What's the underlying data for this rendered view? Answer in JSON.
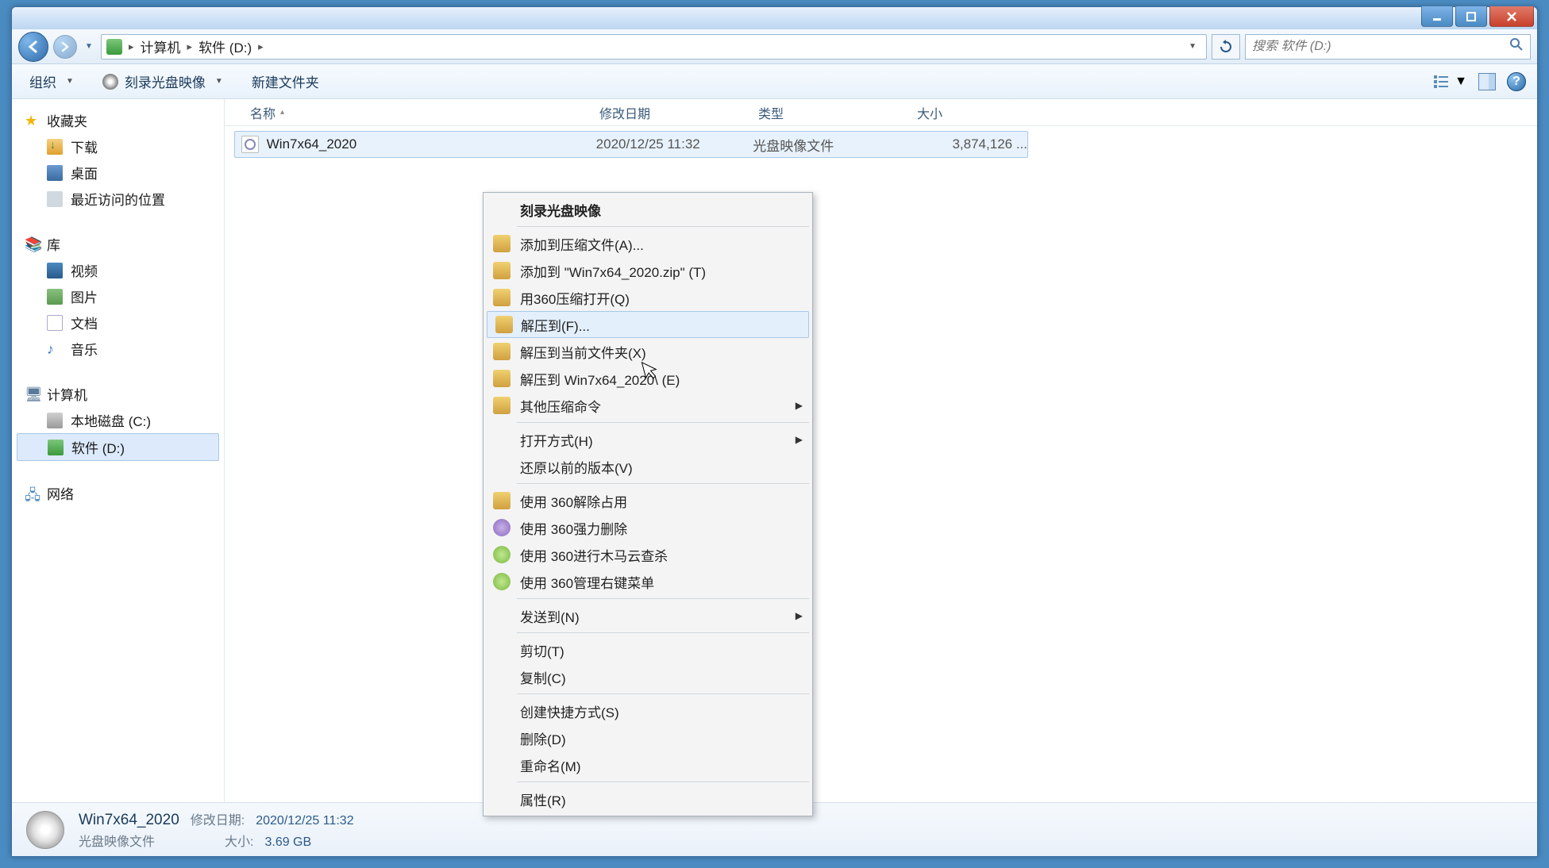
{
  "titlebar": {},
  "nav": {
    "breadcrumb": [
      "计算机",
      "软件 (D:)"
    ],
    "search_placeholder": "搜索 软件 (D:)"
  },
  "toolbar": {
    "organize": "组织",
    "burn": "刻录光盘映像",
    "newfolder": "新建文件夹"
  },
  "sidebar": {
    "favorites_header": "收藏夹",
    "favorites": [
      "下载",
      "桌面",
      "最近访问的位置"
    ],
    "libraries_header": "库",
    "libraries": [
      "视频",
      "图片",
      "文档",
      "音乐"
    ],
    "computer_header": "计算机",
    "drives": [
      "本地磁盘 (C:)",
      "软件 (D:)"
    ],
    "network_header": "网络"
  },
  "columns": {
    "name": "名称",
    "date": "修改日期",
    "type": "类型",
    "size": "大小"
  },
  "files": [
    {
      "name": "Win7x64_2020",
      "date": "2020/12/25 11:32",
      "type": "光盘映像文件",
      "size": "3,874,126 ..."
    }
  ],
  "context_menu": {
    "items": [
      {
        "label": "刻录光盘映像",
        "bold": true
      },
      {
        "sep": true
      },
      {
        "label": "添加到压缩文件(A)...",
        "icon": "zip"
      },
      {
        "label": "添加到 \"Win7x64_2020.zip\" (T)",
        "icon": "zip"
      },
      {
        "label": "用360压缩打开(Q)",
        "icon": "zip"
      },
      {
        "label": "解压到(F)...",
        "icon": "zip",
        "hover": true
      },
      {
        "label": "解压到当前文件夹(X)",
        "icon": "zip"
      },
      {
        "label": "解压到 Win7x64_2020\\ (E)",
        "icon": "zip"
      },
      {
        "label": "其他压缩命令",
        "icon": "zip",
        "submenu": true
      },
      {
        "sep": true
      },
      {
        "label": "打开方式(H)",
        "submenu": true
      },
      {
        "label": "还原以前的版本(V)"
      },
      {
        "sep": true
      },
      {
        "label": "使用 360解除占用",
        "icon": "box"
      },
      {
        "label": "使用 360强力删除",
        "icon": "purple"
      },
      {
        "label": "使用 360进行木马云查杀",
        "icon": "green"
      },
      {
        "label": "使用 360管理右键菜单",
        "icon": "green"
      },
      {
        "sep": true
      },
      {
        "label": "发送到(N)",
        "submenu": true
      },
      {
        "sep": true
      },
      {
        "label": "剪切(T)"
      },
      {
        "label": "复制(C)"
      },
      {
        "sep": true
      },
      {
        "label": "创建快捷方式(S)"
      },
      {
        "label": "删除(D)"
      },
      {
        "label": "重命名(M)"
      },
      {
        "sep": true
      },
      {
        "label": "属性(R)"
      }
    ]
  },
  "status": {
    "filename": "Win7x64_2020",
    "date_label": "修改日期:",
    "date_value": "2020/12/25 11:32",
    "type": "光盘映像文件",
    "size_label": "大小:",
    "size_value": "3.69 GB"
  }
}
